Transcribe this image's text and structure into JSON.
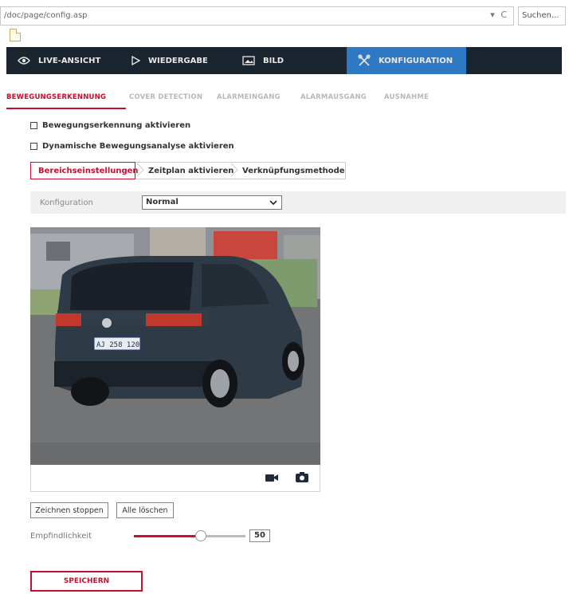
{
  "browser": {
    "url": "/doc/page/config.asp",
    "refresh_controls": "▾ C",
    "search_placeholder": "Suchen..."
  },
  "navbar": {
    "items": [
      {
        "label": "LIVE-ANSICHT",
        "icon": "eye-icon"
      },
      {
        "label": "WIEDERGABE",
        "icon": "play-icon"
      },
      {
        "label": "BILD",
        "icon": "image-icon"
      },
      {
        "label": "KONFIGURATION",
        "icon": "tools-icon",
        "active": true
      }
    ],
    "bg_color": "#1b2530",
    "active_color": "#2f78c4"
  },
  "subtabs": [
    {
      "label": "BEWEGUNGSERKENNUNG",
      "active": true
    },
    {
      "label": "COVER DETECTION"
    },
    {
      "label": "ALARMEINGANG"
    },
    {
      "label": "ALARMAUSGANG"
    },
    {
      "label": "AUSNAHME"
    }
  ],
  "checkboxes": [
    {
      "label": "Bewegungserkennung aktivieren",
      "checked": false
    },
    {
      "label": "Dynamische Bewegungsanalyse aktivieren",
      "checked": false
    }
  ],
  "steps": [
    {
      "label": "Bereichseinstellungen",
      "active": true
    },
    {
      "label": "Zeitplan aktivieren"
    },
    {
      "label": "Verknüpfungsmethode"
    }
  ],
  "config": {
    "label": "Konfiguration",
    "value": "Normal"
  },
  "video": {
    "plate": "AJ 258 120",
    "toolbar_icons": [
      "record-icon",
      "camera-icon"
    ]
  },
  "buttons": {
    "stop_draw": "Zeichnen stoppen",
    "clear_all": "Alle löschen",
    "save": "SPEICHERN"
  },
  "sensitivity": {
    "label": "Empfindlichkeit",
    "value": "50",
    "level": 0.5
  },
  "accent_color": "#c8102e"
}
